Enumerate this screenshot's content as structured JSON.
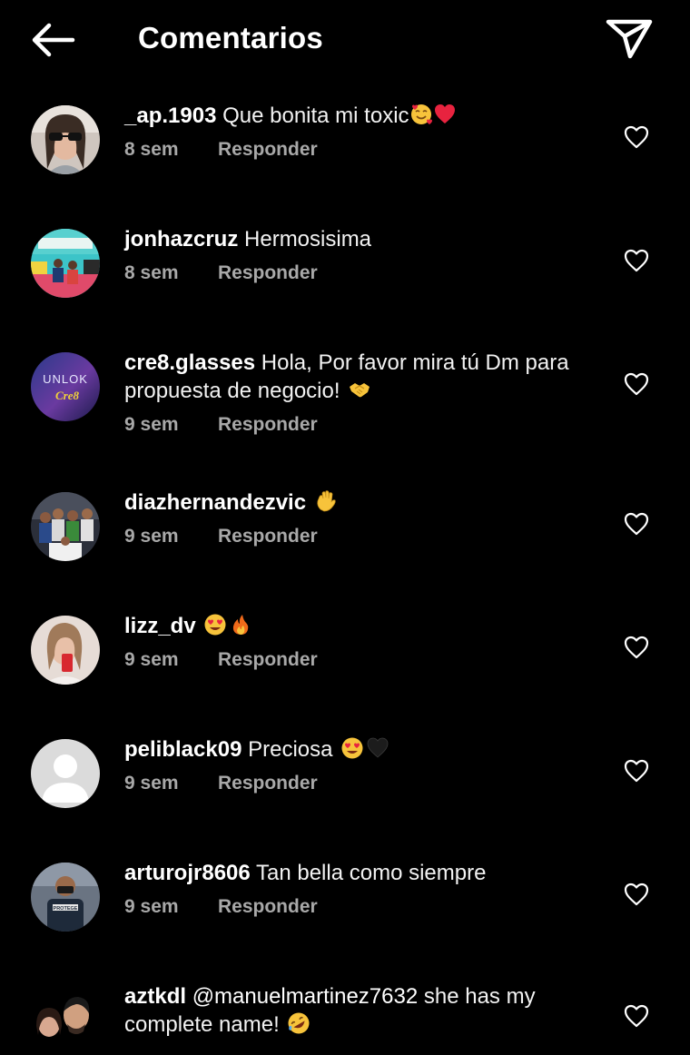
{
  "header": {
    "title": "Comentarios"
  },
  "comments": [
    {
      "username": "_ap.1903",
      "text": "Que bonita mi toxic",
      "emojis": [
        "smiling-face-with-hearts",
        "red-heart"
      ],
      "time": "8 sem",
      "reply": "Responder"
    },
    {
      "username": "jonhazcruz",
      "text": "Hermosisima",
      "emojis": [],
      "time": "8 sem",
      "reply": "Responder"
    },
    {
      "username": "cre8.glasses",
      "text": "Hola, Por favor mira tú Dm para propuesta de negocio!",
      "emojis": [
        "handshake"
      ],
      "time": "9 sem",
      "reply": "Responder",
      "avatar_text": [
        "UNLOK",
        "Cre8"
      ]
    },
    {
      "username": "diazhernandezvic",
      "text": "",
      "emojis": [
        "waving-hand"
      ],
      "time": "9 sem",
      "reply": "Responder"
    },
    {
      "username": "lizz_dv",
      "text": "",
      "emojis": [
        "heart-eyes",
        "fire"
      ],
      "time": "9 sem",
      "reply": "Responder"
    },
    {
      "username": "peliblack09",
      "text": "Preciosa",
      "emojis": [
        "heart-eyes",
        "black-heart"
      ],
      "time": "9 sem",
      "reply": "Responder"
    },
    {
      "username": "arturojr8606",
      "text": "Tan bella como siempre",
      "emojis": [],
      "time": "9 sem",
      "reply": "Responder",
      "avatar_text": [
        "PROTEGE"
      ]
    },
    {
      "username": "aztkdl",
      "mention": "@manuelmartinez7632",
      "text": "she has my complete name!",
      "emojis": [
        "rolling-laughing"
      ],
      "time": "",
      "reply": ""
    }
  ],
  "icons": {
    "back": "arrow-left-icon",
    "share": "paper-plane-icon",
    "like": "heart-outline-icon"
  },
  "colors": {
    "background": "#000000",
    "text": "#ffffff",
    "meta": "#a8a8a8"
  }
}
